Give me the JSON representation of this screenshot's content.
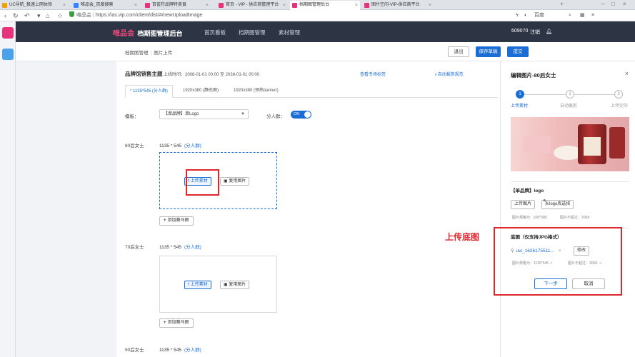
{
  "browser": {
    "tabs": [
      {
        "label": "UC导航_极速上网体验",
        "fav_color": "#f4a100",
        "active": false
      },
      {
        "label": "唯品会_百度搜索",
        "fav_color": "#3385ff",
        "active": false
      },
      {
        "label": "百雀羚品牌特卖頁",
        "fav_color": "#e8327c",
        "active": false
      },
      {
        "label": "首页 - VIP - 供应商管理平台",
        "fav_color": "#e8327c",
        "active": false
      },
      {
        "label": "档期图管理后台",
        "fav_color": "#e8327c",
        "active": true
      },
      {
        "label": "图片空间-VIP-供应商平台",
        "fav_color": "#e8327c",
        "active": false
      }
    ],
    "url_site": "唯品会",
    "url_path": "https://ias.vip.com/client/dist/#/newUploadImage",
    "search_engine": "百度"
  },
  "header": {
    "brand": "唯品会",
    "title": "档期图管理后台",
    "nav": [
      "首页看板",
      "档期图管理",
      "素材管理"
    ],
    "user_id": "609070",
    "logout": "注销"
  },
  "subheader": {
    "breadcrumb": [
      "档期图管理",
      "图片上传"
    ],
    "exit": "退出",
    "save_draft": "保存草稿",
    "submit": "提交"
  },
  "main": {
    "title": "品牌馆销售主题",
    "time": "上线时间：2008-01-01 00:00 至 2038-01-01 00:00",
    "view_topic": "查看专场标签",
    "auto_crop": "自动裁剪规范",
    "tabs": [
      "* 1135*545 (分人群)",
      "1920x380 (静态图)",
      "1920x380 (预热banner)"
    ],
    "template_label": "模板：",
    "template_value": "【单品牌】单Logo",
    "group_label": "分人群：",
    "toggle_text": "ON",
    "sections": [
      {
        "label": "80后女士",
        "size": "1135 * 545",
        "group": "(分人群)"
      },
      {
        "label": "70后女士",
        "size": "1135 * 545",
        "group": "(分人群)"
      },
      {
        "label": "90后女士",
        "size": "1135 * 545",
        "group": "(分人群)"
      }
    ],
    "upload_btn": "上传素材",
    "reuse_btn": "复用图片",
    "add_carousel": "添加赛马图"
  },
  "edit_panel": {
    "title": "编辑图片-80后女士",
    "close": "×",
    "steps": [
      {
        "num": "1",
        "label": "上传素材"
      },
      {
        "num": "2",
        "label": "自动裁剪"
      },
      {
        "num": "3",
        "label": "上传完毕"
      }
    ],
    "logo_section": "【单品牌】logo",
    "upload_image": "上传图片",
    "logo_library": "从logo库选择",
    "logo_size_note": "图片规格为：600*300",
    "logo_limit_note": "图片不超过：200K",
    "base_section": "底图（仅支持JPG格式）",
    "file_name": "ias_1626175511...",
    "modify": "修改",
    "base_size_note": "图片规格为：1135*545",
    "base_limit_note": "图片不超过：300K",
    "next": "下一步",
    "cancel": "取消"
  },
  "annotation": {
    "callout": "上传底图",
    "accent": "#e0262d"
  },
  "colors": {
    "header_bg": "#2d3444",
    "primary": "#1a6dd4",
    "brand_pink": "#f2497e"
  }
}
